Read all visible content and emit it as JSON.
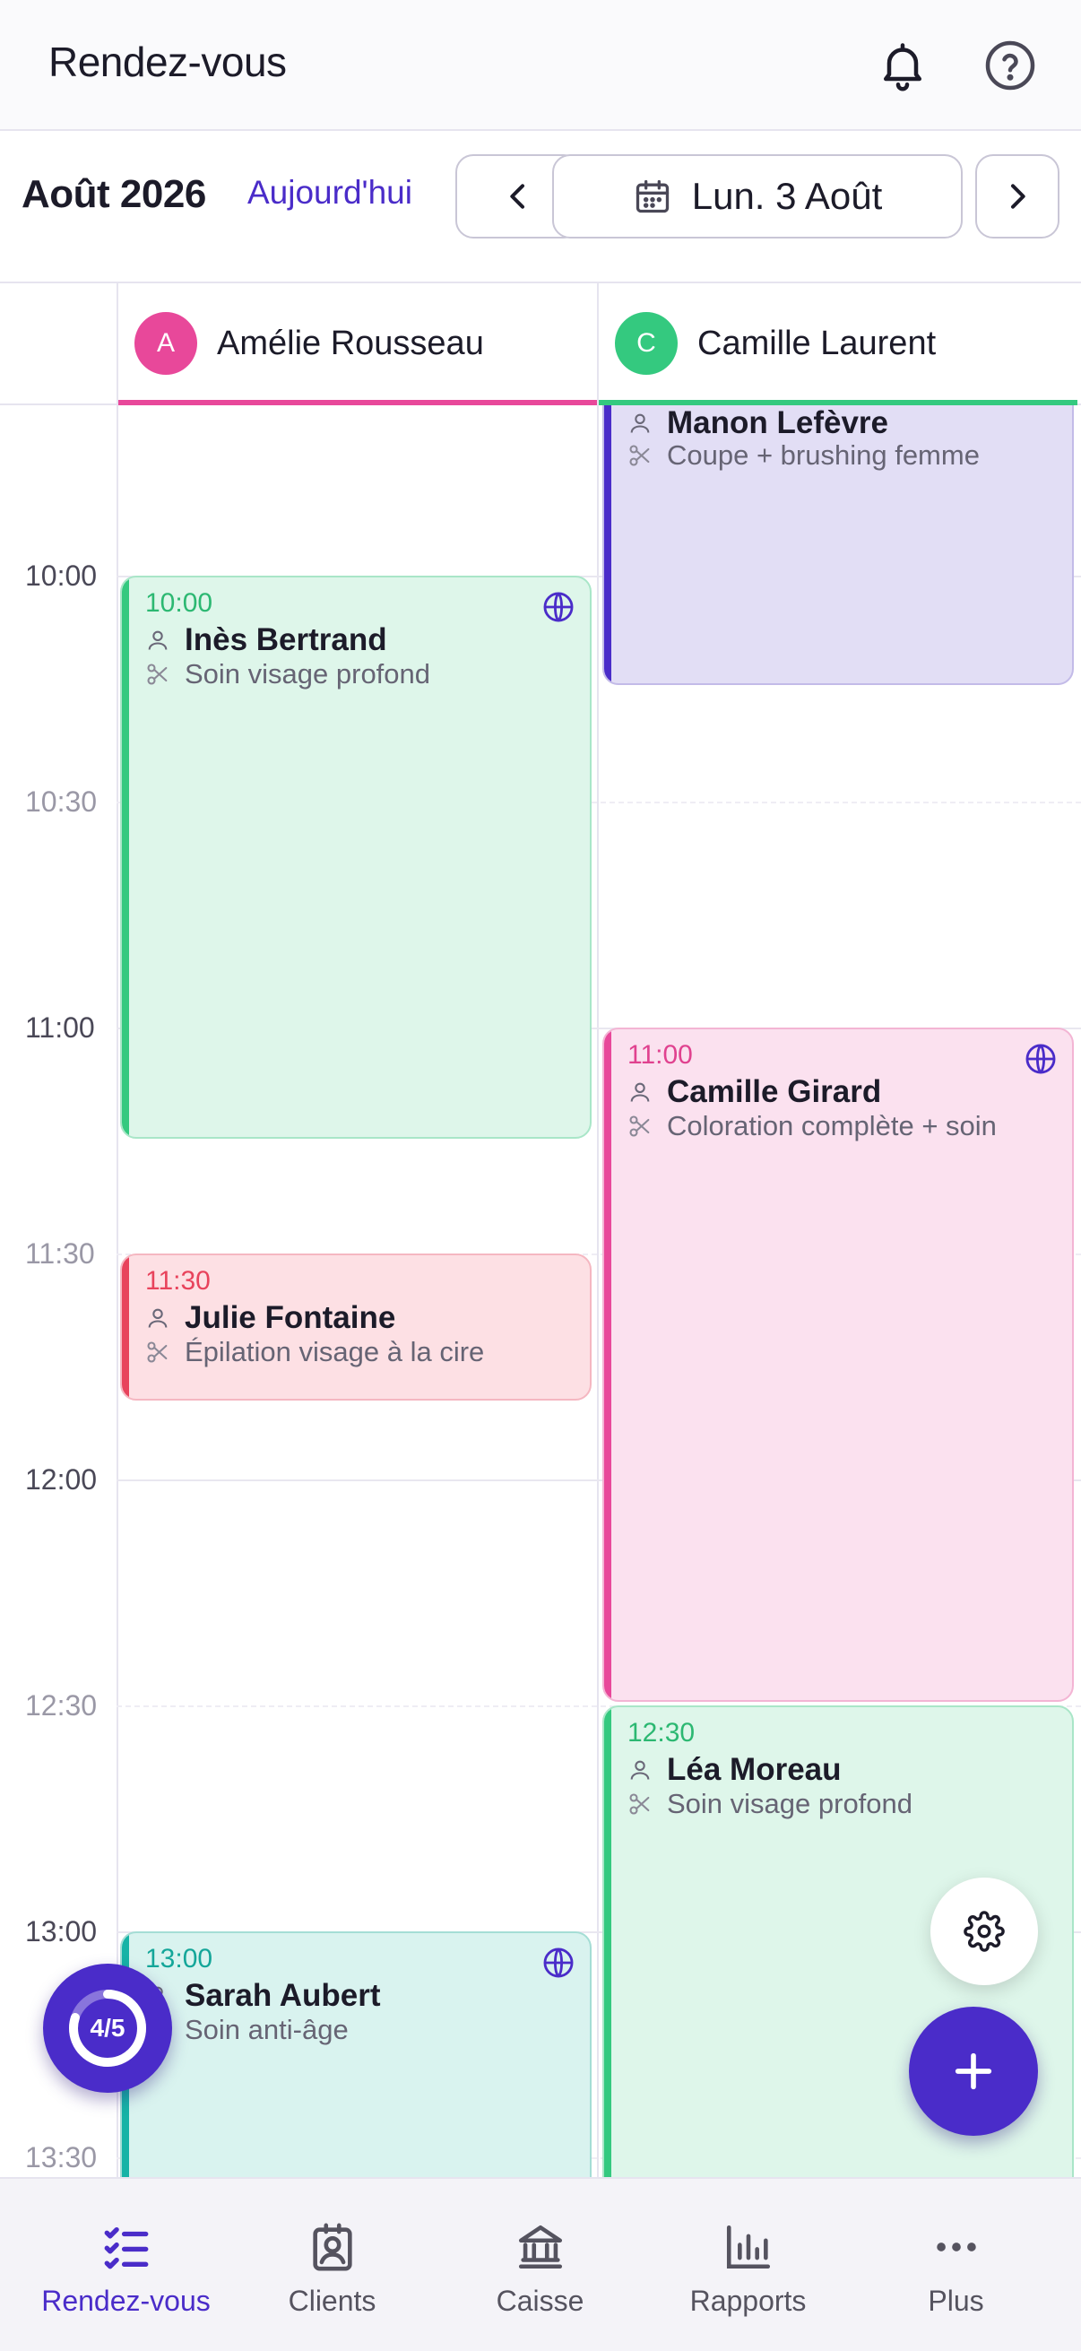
{
  "header": {
    "title": "Rendez-vous",
    "icons": [
      "bell-icon",
      "help-icon"
    ]
  },
  "datebar": {
    "month": "Août 2026",
    "today_label": "Aujourd'hui",
    "selected_date": "Lun. 3 Août",
    "icons": [
      "chevron-left-icon",
      "calendar-icon",
      "chevron-right-icon"
    ]
  },
  "staff": [
    {
      "initial": "A",
      "name": "Amélie Rousseau",
      "color": "#e8489a"
    },
    {
      "initial": "C",
      "name": "Camille Laurent",
      "color": "#34c97f"
    }
  ],
  "time_labels": [
    "10:00",
    "10:30",
    "11:00",
    "11:30",
    "12:00",
    "12:30",
    "13:00",
    "13:30"
  ],
  "appointments": {
    "manon": {
      "client": "Manon Lefèvre",
      "service": "Coupe + brushing femme",
      "color": "#4a2cc9"
    },
    "ines": {
      "time": "10:00",
      "client": "Inès Bertrand",
      "service": "Soin visage profond",
      "color": "#34c97f",
      "online": true
    },
    "julie": {
      "time": "11:30",
      "client": "Julie Fontaine",
      "service": "Épilation visage à la cire",
      "color": "#e8435c"
    },
    "sarah": {
      "time": "13:00",
      "client": "Sarah Aubert",
      "service": "Soin anti-âge",
      "color": "#16b3a6",
      "online": true
    },
    "camille": {
      "time": "11:00",
      "client": "Camille Girard",
      "service": "Coloration complète + soin",
      "color": "#e8489a",
      "online": true
    },
    "lea": {
      "time": "12:30",
      "client": "Léa Moreau",
      "service": "Soin visage profond",
      "color": "#34c97f"
    }
  },
  "progress": {
    "label": "4/5",
    "value": 0.8
  },
  "bottom_nav": [
    {
      "label": "Rendez-vous",
      "icon": "checklist-icon",
      "active": true
    },
    {
      "label": "Clients",
      "icon": "contact-card-icon",
      "active": false
    },
    {
      "label": "Caisse",
      "icon": "bank-icon",
      "active": false
    },
    {
      "label": "Rapports",
      "icon": "bar-chart-icon",
      "active": false
    },
    {
      "label": "Plus",
      "icon": "more-icon",
      "active": false
    }
  ],
  "colors": {
    "accent": "#4a2cc9"
  }
}
